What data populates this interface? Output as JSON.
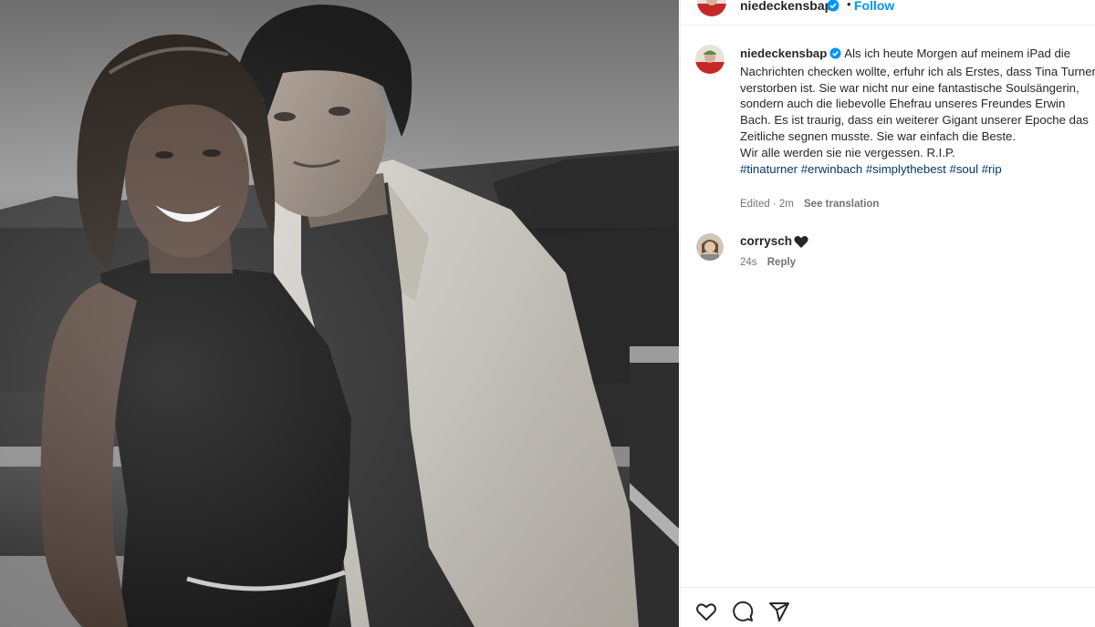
{
  "post_author": {
    "username": "niedeckensbap",
    "separator": "•",
    "follow_label": "Follow"
  },
  "caption": {
    "username": "niedeckensbap",
    "text": "Als ich heute Morgen auf meinem iPad die Nachrichten checken wollte, erfuhr ich als Erstes, dass Tina Turner verstorben ist. Sie war nicht nur eine fantastische Soulsängerin, sondern auch die liebevolle Ehefrau unseres Freundes Erwin Bach. Es ist traurig, dass ein weiterer Gigant unserer Epoche das Zeitliche segnen musste. Sie war einfach die Beste.",
    "line2": "Wir alle werden sie nie vergessen. R.I.P.",
    "hashtags": [
      "#tinaturner",
      "#erwinbach",
      "#simplythebest",
      "#soul",
      "#rip"
    ],
    "edited": "Edited · 2m",
    "see_translation": "See translation"
  },
  "comments": [
    {
      "username": "corrysch",
      "time": "24s",
      "reply_label": "Reply"
    }
  ],
  "icons": {
    "verified": "verified-badge-icon",
    "heart": "heart-icon",
    "comment": "comment-icon",
    "share": "share-icon"
  },
  "colors": {
    "link_blue": "#0095f6",
    "hashtag": "#00376b",
    "muted": "#737373"
  }
}
